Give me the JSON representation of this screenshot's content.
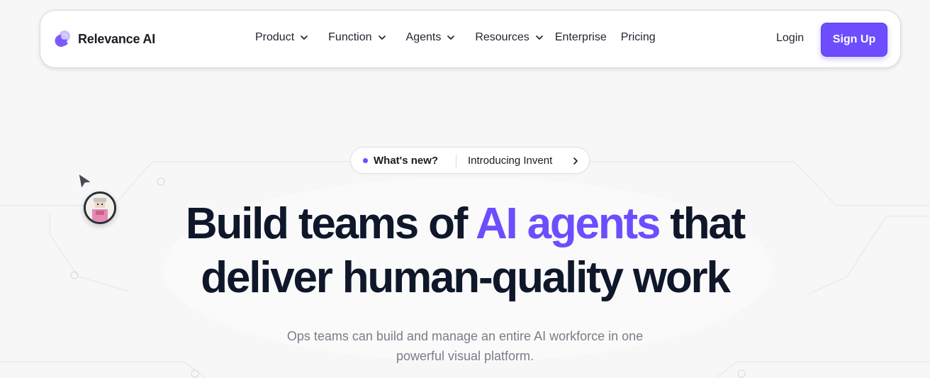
{
  "brand": {
    "name": "Relevance AI",
    "logo": "relevance-logo-icon",
    "accent_color": "#6d4dff"
  },
  "nav": {
    "items": [
      {
        "label": "Product",
        "has_dropdown": true
      },
      {
        "label": "Function",
        "has_dropdown": true
      },
      {
        "label": "Agents",
        "has_dropdown": true
      },
      {
        "label": "Resources",
        "has_dropdown": true
      },
      {
        "label": "Enterprise",
        "has_dropdown": false
      },
      {
        "label": "Pricing",
        "has_dropdown": false
      }
    ],
    "login_label": "Login",
    "signup_label": "Sign Up"
  },
  "badge": {
    "tag": "What's new?",
    "text": "Introducing Invent",
    "icon": "chevron-right-icon"
  },
  "hero": {
    "title_part1": "Build teams of ",
    "title_accent": "AI agents",
    "title_part2": " that",
    "title_line2": "deliver human-quality work",
    "subtitle_line1": "Ops teams can build and manage an entire AI workforce in one",
    "subtitle_line2": "powerful visual platform."
  }
}
